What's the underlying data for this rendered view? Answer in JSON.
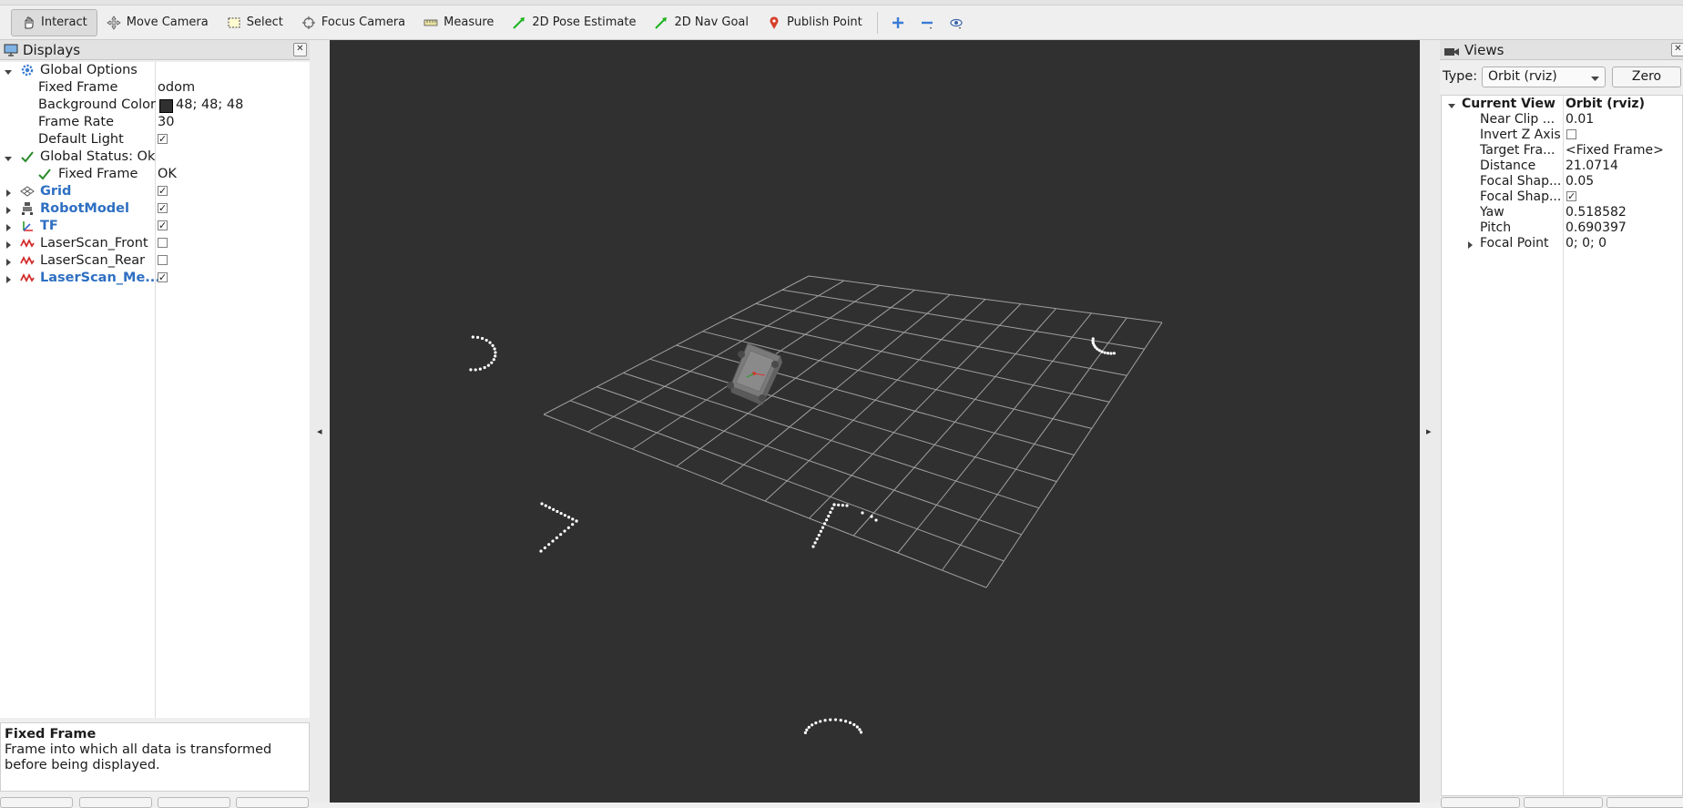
{
  "toolbar": {
    "tools": [
      {
        "label": "Interact",
        "icon": "hand-icon",
        "active": true
      },
      {
        "label": "Move Camera",
        "icon": "move-camera-icon"
      },
      {
        "label": "Select",
        "icon": "select-icon"
      },
      {
        "label": "Focus Camera",
        "icon": "focus-camera-icon"
      },
      {
        "label": "Measure",
        "icon": "ruler-icon"
      },
      {
        "label": "2D Pose Estimate",
        "icon": "green-arrow-icon"
      },
      {
        "label": "2D Nav Goal",
        "icon": "green-arrow-icon"
      },
      {
        "label": "Publish Point",
        "icon": "map-pin-icon"
      }
    ]
  },
  "displays": {
    "title": "Displays",
    "rows": [
      {
        "name": "Global Options",
        "value": ""
      },
      {
        "name": "Fixed Frame",
        "value": "odom"
      },
      {
        "name": "Background Color",
        "value": "48; 48; 48"
      },
      {
        "name": "Frame Rate",
        "value": "30"
      },
      {
        "name": "Default Light",
        "value": ""
      },
      {
        "name": "Global Status: Ok",
        "value": ""
      },
      {
        "name": "Fixed Frame",
        "value": "OK"
      },
      {
        "name": "Grid",
        "value": ""
      },
      {
        "name": "RobotModel",
        "value": ""
      },
      {
        "name": "TF",
        "value": ""
      },
      {
        "name": "LaserScan_Front",
        "value": ""
      },
      {
        "name": "LaserScan_Rear",
        "value": ""
      },
      {
        "name": "LaserScan_Me...",
        "value": ""
      }
    ],
    "checks": {
      "default_light": true,
      "grid": true,
      "robotmodel": true,
      "tf": true,
      "laserscan_front": false,
      "laserscan_rear": false,
      "laserscan_merged": true
    }
  },
  "description": {
    "title": "Fixed Frame",
    "body": "Frame into which all data is transformed before being displayed."
  },
  "views": {
    "title": "Views",
    "type_label": "Type:",
    "type_value": "Orbit (rviz)",
    "zero_label": "Zero",
    "rows": [
      {
        "name": "Current View",
        "value": "Orbit (rviz)"
      },
      {
        "name": "Near Clip ...",
        "value": "0.01"
      },
      {
        "name": "Invert Z Axis",
        "value": ""
      },
      {
        "name": "Target Fra...",
        "value": "<Fixed Frame>"
      },
      {
        "name": "Distance",
        "value": "21.0714"
      },
      {
        "name": "Focal Shap...",
        "value": "0.05"
      },
      {
        "name": "Focal Shap...",
        "value": ""
      },
      {
        "name": "Yaw",
        "value": "0.518582"
      },
      {
        "name": "Pitch",
        "value": "0.690397"
      },
      {
        "name": "Focal Point",
        "value": "0; 0; 0"
      }
    ],
    "checks": {
      "invert_z": false,
      "focal_shape_fixed": true
    }
  },
  "colors": {
    "background": "#303030",
    "grid_line": "#a0a0a0",
    "scan_points": "#ffffff",
    "link_blue": "#2e6fc2",
    "status_ok_green": "#2a8a2a"
  }
}
